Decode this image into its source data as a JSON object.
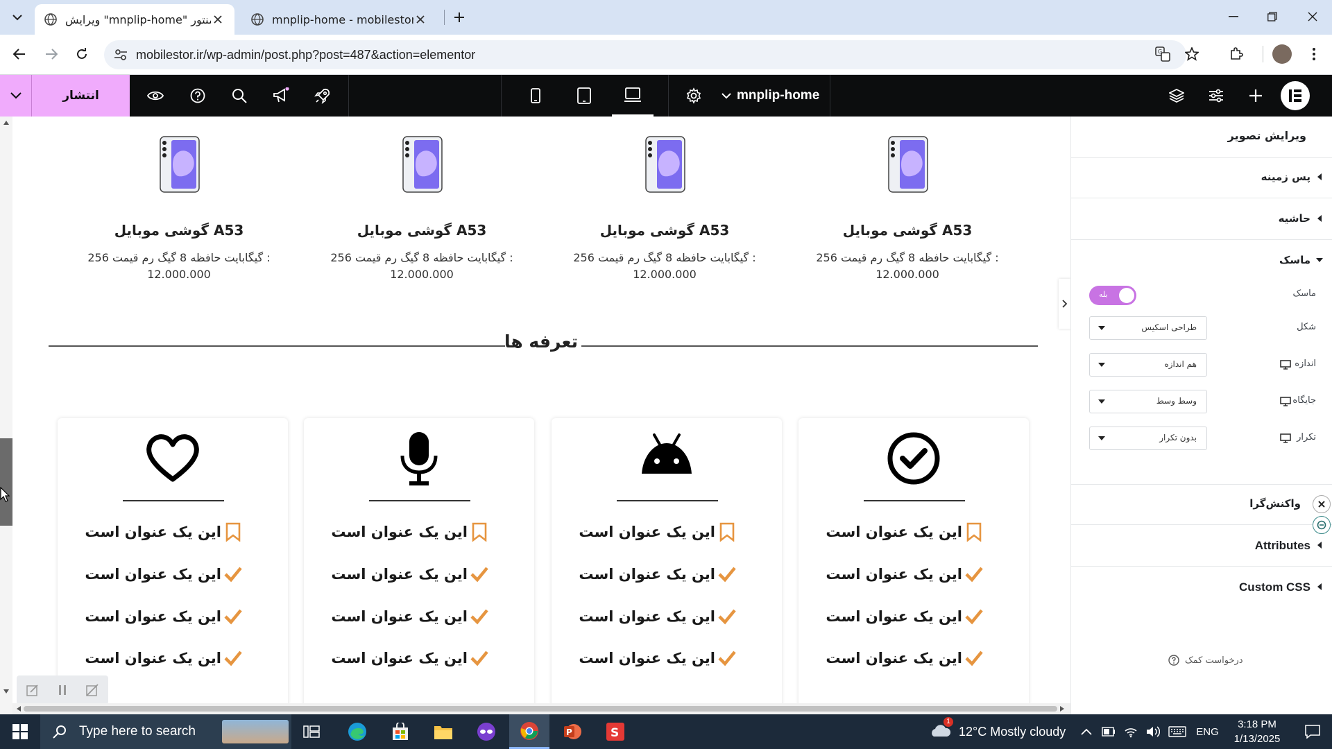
{
  "browser": {
    "tabs": [
      {
        "title": "ویرایش \"mnplip-home\" با المنتور",
        "active": true
      },
      {
        "title": "mnplip-home - mobilestore",
        "active": false
      }
    ],
    "url": "mobilestor.ir/wp-admin/post.php?post=487&action=elementor"
  },
  "elementor": {
    "publish_label": "انتشار",
    "page_name": "mnplip-home"
  },
  "products": [
    {
      "title": "گوشی موبایل A53",
      "desc_line1": "256 گیگابایت حافظه 8 گیگ رم قیمت :",
      "price": "12.000.000"
    },
    {
      "title": "گوشی موبایل A53",
      "desc_line1": "256 گیگابایت حافظه 8 گیگ رم قیمت :",
      "price": "12.000.000"
    },
    {
      "title": "گوشی موبایل A53",
      "desc_line1": "256 گیگابایت حافظه 8 گیگ رم قیمت :",
      "price": "12.000.000"
    },
    {
      "title": "گوشی موبایل A53",
      "desc_line1": "256 گیگابایت حافظه 8 گیگ رم قیمت :",
      "price": "12.000.000"
    }
  ],
  "section_title": "تعرفه ها",
  "plans": [
    {
      "icon": "heart-icon",
      "features": [
        "این یک عنوان است",
        "این یک عنوان است",
        "این یک عنوان است",
        "این یک عنوان است"
      ]
    },
    {
      "icon": "microphone-icon",
      "features": [
        "این یک عنوان است",
        "این یک عنوان است",
        "این یک عنوان است",
        "این یک عنوان است"
      ]
    },
    {
      "icon": "android-icon",
      "features": [
        "این یک عنوان است",
        "این یک عنوان است",
        "این یک عنوان است",
        "این یک عنوان است"
      ]
    },
    {
      "icon": "check-circle-icon",
      "features": [
        "این یک عنوان است",
        "این یک عنوان است",
        "این یک عنوان است",
        "این یک عنوان است"
      ]
    }
  ],
  "feature_icons": [
    "bookmark-icon",
    "check-icon",
    "check-icon",
    "check-icon"
  ],
  "panel": {
    "title": "ویرایش تصویر",
    "sections": {
      "background": "پس زمینه",
      "border": "حاشیه",
      "mask": "ماسک",
      "responsive": "واکنش‌گرا",
      "attributes": "Attributes",
      "custom_css": "Custom CSS"
    },
    "mask_label": "ماسک",
    "mask_toggle": "بله",
    "shape_label": "شکل",
    "shape_value": "طراحی اسکیس",
    "size_label": "اندازه",
    "size_value": "هم اندازه",
    "position_label": "جایگاه",
    "position_value": "وسط وسط",
    "repeat_label": "تکرار",
    "repeat_value": "بدون تکرار",
    "help": "درخواست کمک"
  },
  "taskbar": {
    "search_placeholder": "Type here to search",
    "weather": "12°C  Mostly cloudy",
    "lang": "ENG",
    "time": "3:18 PM",
    "date": "1/13/2025"
  },
  "colors": {
    "publish": "#f0abfc",
    "accent_orange": "#e69540",
    "toggle": "#c873e3",
    "topbar": "#0c0d0e"
  }
}
